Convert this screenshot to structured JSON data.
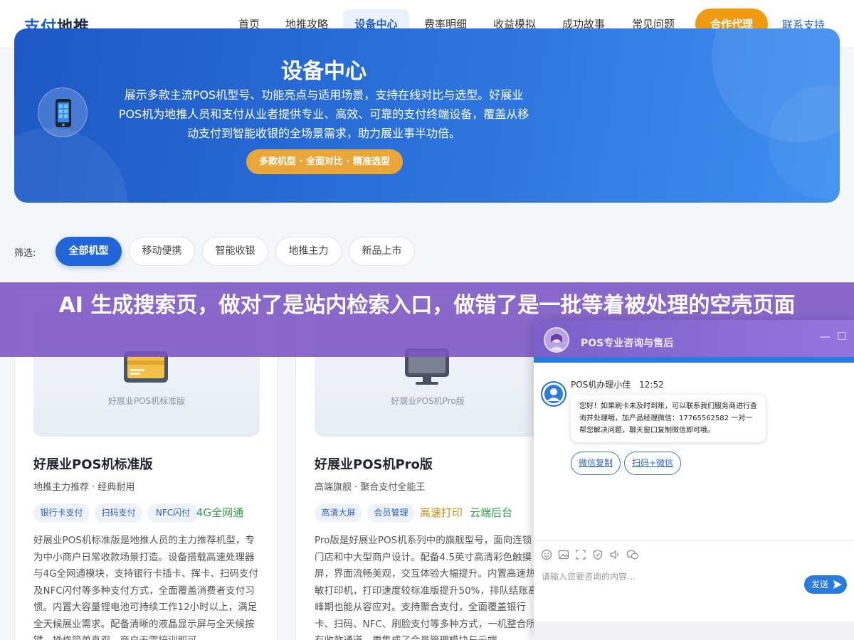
{
  "header": {
    "logo_part1": "支付",
    "logo_part2": "地推",
    "nav": [
      "首页",
      "地推攻略",
      "设备中心",
      "费率明细",
      "收益模拟",
      "成功故事",
      "常见问题"
    ],
    "active_nav": "设备中心",
    "cta_label": "合作代理",
    "support_label": "联系支持"
  },
  "hero": {
    "title": "设备中心",
    "description": "展示多款主流POS机型号、功能亮点与适用场景，支持在线对比与选型。好展业POS机为地推人员和支付从业者提供专业、高效、可靠的支付终端设备，覆盖从移动支付到智能收银的全场景需求，助力展业事半功倍。",
    "badge": "多款机型 · 全面对比 · 精准选型",
    "icon": "phone-icon"
  },
  "filter": {
    "label": "筛选:",
    "chips": [
      "全部机型",
      "移动便携",
      "智能收银",
      "地推主力",
      "新品上市"
    ],
    "active": "全部机型"
  },
  "cards": [
    {
      "image_label": "好展业POS机标准版",
      "icon": "card-icon",
      "title": "好展业POS机标准版",
      "subtitle": "地推主力推荐 · 经典耐用",
      "tags": [
        "银行卡支付",
        "扫码支付",
        "NFC闪付",
        "4G全网通"
      ],
      "description": "好展业POS机标准版是地推人员的主力推荐机型，专为中小商户日常收款场景打造。设备搭载高速处理器与4G全网通模块，支持银行卡插卡、挥卡、扫码支付及NFC闪付等多种支付方式，全面覆盖消费者支付习惯。内置大容量锂电池可持续工作12小时以上，满足全天候展业需求。配备清晰的液晶显示屏与全天候按键，操作简单直观，商户无需培训即可"
    },
    {
      "image_label": "好展业POS机Pro版",
      "icon": "monitor-icon",
      "title": "好展业POS机Pro版",
      "subtitle": "高端旗舰 · 聚合支付全能王",
      "tags": [
        "高清大屏",
        "会员管理",
        "高速打印",
        "云端后台"
      ],
      "description": "Pro版是好展业POS机系列中的旗舰型号，面向连锁门店和中大型商户设计。配备4.5英寸高清彩色触摸屏，界面流畅美观，交互体验大幅提升。内置高速热敏打印机，打印速度较标准版提升50%，排队结账高峰期也能从容应对。支持聚合支付，全面覆盖银行卡、扫码、NFC、刷脸支付等多种方式，一机整合所有收款通道，更集成了会员管理模块与云端"
    }
  ],
  "banner": {
    "text": "AI 生成搜索页，做对了是站内检索入口，做错了是一批等着被处理的空壳页面"
  },
  "chat": {
    "title": "POS专业咨询与售后",
    "minimize": "—",
    "maximize": "☐",
    "agent_name": "POS机办理小佳",
    "time": "12:52",
    "message": "您好！如果刷卡未及时到账，可以联系我们服务商进行查询并处理哦，加产品经理微信：17765562582 一对一帮您解决问题，聊天窗口复制微信即可哦。",
    "quick_buttons": [
      "微信复制",
      "扫码+微信"
    ],
    "toolbar_icons": [
      "emoji-icon",
      "image-icon",
      "screenshot-icon",
      "evaluate-icon",
      "voice-icon",
      "chat-icon"
    ],
    "input_placeholder": "请输入您要咨询的内容...",
    "send_label": "发送"
  }
}
